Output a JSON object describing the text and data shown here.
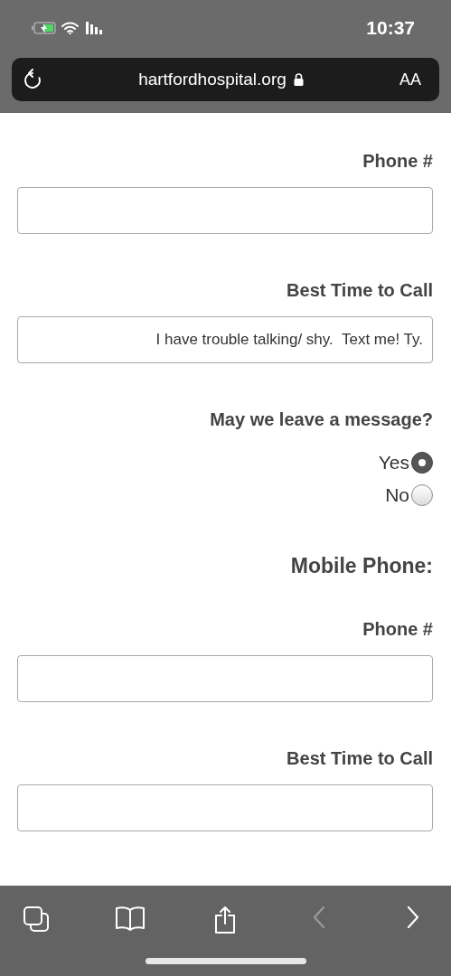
{
  "status_bar": {
    "time": "10:37"
  },
  "address_bar": {
    "url": "hartfordhospital.org",
    "text_size_button": "AA"
  },
  "form": [
    {
      "kind": "label",
      "text": "Phone #"
    },
    {
      "kind": "field"
    },
    {
      "kind": "label",
      "text": "Best Time to Call"
    },
    {
      "kind": "field",
      "value": "I have trouble talking/ shy.  Text me! Ty."
    },
    {
      "kind": "label",
      "text": "May we leave a message?"
    },
    {
      "kind": "radios",
      "options": [
        {
          "label": "Yes",
          "selected": true
        },
        {
          "label": "No",
          "selected": false
        }
      ]
    },
    {
      "kind": "heading",
      "text": "Mobile Phone:"
    },
    {
      "kind": "label",
      "text": "Phone #"
    },
    {
      "kind": "field"
    },
    {
      "kind": "label",
      "text": "Best Time to Call"
    },
    {
      "kind": "field"
    }
  ],
  "toolbar": [
    {
      "kind": "tabs"
    },
    {
      "kind": "bookmarks"
    },
    {
      "kind": "share"
    },
    {
      "kind": "chevron_left",
      "disabled": true
    },
    {
      "kind": "chevron_right",
      "disabled": false
    }
  ]
}
